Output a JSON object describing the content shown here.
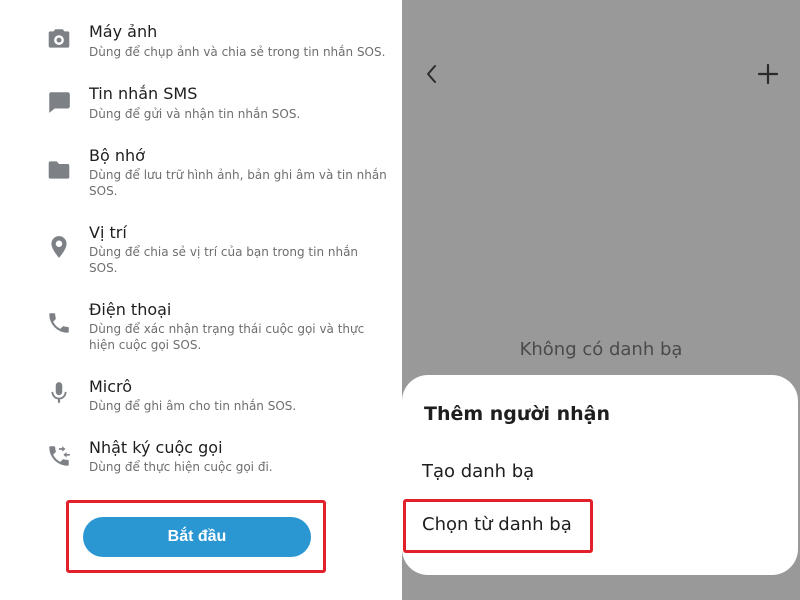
{
  "permissions": [
    {
      "icon": "camera-icon",
      "title": "Máy ảnh",
      "desc": "Dùng để chụp ảnh và chia sẻ trong tin nhắn SOS."
    },
    {
      "icon": "message-icon",
      "title": "Tin nhắn SMS",
      "desc": "Dùng để gửi và nhận tin nhắn SOS."
    },
    {
      "icon": "folder-icon",
      "title": "Bộ nhớ",
      "desc": "Dùng để lưu trữ hình ảnh, bản ghi âm và tin nhắn SOS."
    },
    {
      "icon": "location-pin-icon",
      "title": "Vị trí",
      "desc": "Dùng để chia sẻ vị trí của bạn trong tin nhắn SOS."
    },
    {
      "icon": "phone-icon",
      "title": "Điện thoại",
      "desc": "Dùng để xác nhận trạng thái cuộc gọi và thực hiện cuộc gọi SOS."
    },
    {
      "icon": "microphone-icon",
      "title": "Micrô",
      "desc": "Dùng để ghi âm cho tin nhắn SOS."
    },
    {
      "icon": "call-log-icon",
      "title": "Nhật ký cuộc gọi",
      "desc": "Dùng để thực hiện cuộc gọi đi."
    }
  ],
  "start_button": "Bắt đầu",
  "contacts_screen": {
    "back_icon": "back-arrow-icon",
    "add_icon": "plus-icon",
    "empty_text": "Không có danh bạ"
  },
  "sheet": {
    "title": "Thêm người nhận",
    "option_create": "Tạo danh bạ",
    "option_choose": "Chọn từ danh bạ"
  },
  "colors": {
    "accent": "#2a96d2",
    "highlight": "#e0212b",
    "dim_overlay": "#999999",
    "icon_gray": "#7d8186"
  }
}
